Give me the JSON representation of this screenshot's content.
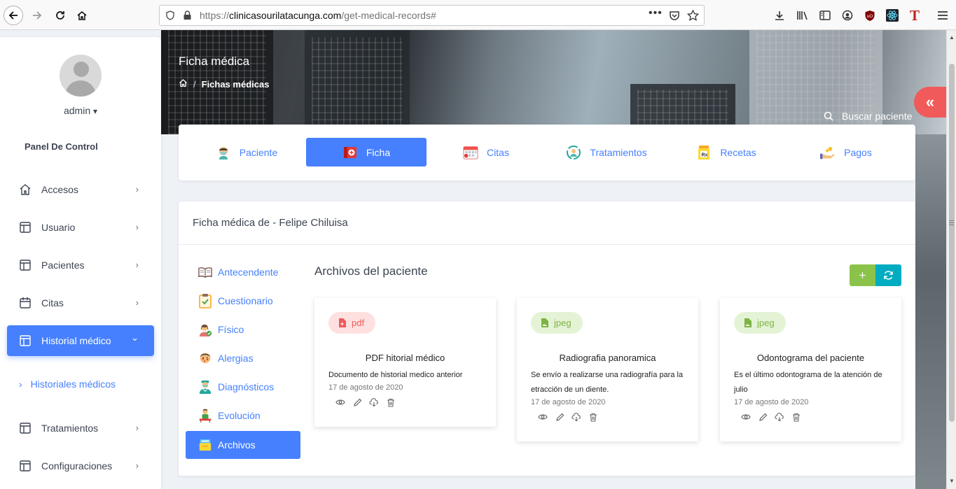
{
  "browser": {
    "url_prefix": "https://",
    "url_domain": "clinicasourilatacunga.com",
    "url_path": "/get-medical-records#"
  },
  "hero": {
    "title": "Ficha médica",
    "breadcrumb_current": "Fichas médicas",
    "breadcrumb_sep": "/",
    "search_label": "Buscar paciente",
    "collapse_glyph": "«"
  },
  "sidebar": {
    "user_name": "admin",
    "user_caret": "▾",
    "panel_label": "Panel De Control",
    "items": [
      {
        "label": "Accesos",
        "icon": "home-icon",
        "chev": "›"
      },
      {
        "label": "Usuario",
        "icon": "layout-icon",
        "chev": "›"
      },
      {
        "label": "Pacientes",
        "icon": "layout-icon",
        "chev": "›"
      },
      {
        "label": "Citas",
        "icon": "calendar-icon",
        "chev": "›"
      },
      {
        "label": "Historial médico",
        "icon": "layout-icon",
        "chev": "⌄"
      },
      {
        "label": "Tratamientos",
        "icon": "layout-icon",
        "chev": "›"
      },
      {
        "label": "Configuraciones",
        "icon": "layout-icon",
        "chev": "›"
      }
    ],
    "submenu": {
      "bullet": "›",
      "label": "Historiales médicos"
    }
  },
  "tabs": [
    {
      "label": "Paciente",
      "icon": "patient-icon"
    },
    {
      "label": "Ficha",
      "icon": "medical-record-icon"
    },
    {
      "label": "Citas",
      "icon": "calendar-icon"
    },
    {
      "label": "Tratamientos",
      "icon": "treatment-icon"
    },
    {
      "label": "Recetas",
      "icon": "prescription-icon"
    },
    {
      "label": "Pagos",
      "icon": "payment-icon"
    }
  ],
  "main": {
    "title": "Ficha médica de - Felipe Chiluisa",
    "sub_nav": [
      {
        "label": "Antecendente",
        "icon": "book-icon"
      },
      {
        "label": "Cuestionario",
        "icon": "clipboard-icon"
      },
      {
        "label": "Físico",
        "icon": "person-check-icon"
      },
      {
        "label": "Alergias",
        "icon": "allergy-icon"
      },
      {
        "label": "Diagnósticos",
        "icon": "doctor-icon"
      },
      {
        "label": "Evolución",
        "icon": "evolution-icon"
      },
      {
        "label": "Archivos",
        "icon": "files-icon"
      }
    ],
    "files_title": "Archivos del paciente",
    "add_label": "+",
    "files": [
      {
        "type": "pdf",
        "name": "PDF hitorial médico",
        "description": "Documento de historial medico anterior",
        "date": "17 de agosto de 2020"
      },
      {
        "type": "jpeg",
        "name": "Radiografia panoramica",
        "description": "Se envío a realizarse una radiografía para la etracción de un diente.",
        "date": "17 de agosto de 2020"
      },
      {
        "type": "jpeg",
        "name": "Odontograma del paciente",
        "description": "Es el último odontograma de la atención de julio",
        "date": "17 de agosto de 2020"
      }
    ]
  },
  "colors": {
    "primary": "#4680ff",
    "success": "#8bc34a",
    "info": "#00acc1",
    "danger": "#f05a5a"
  }
}
